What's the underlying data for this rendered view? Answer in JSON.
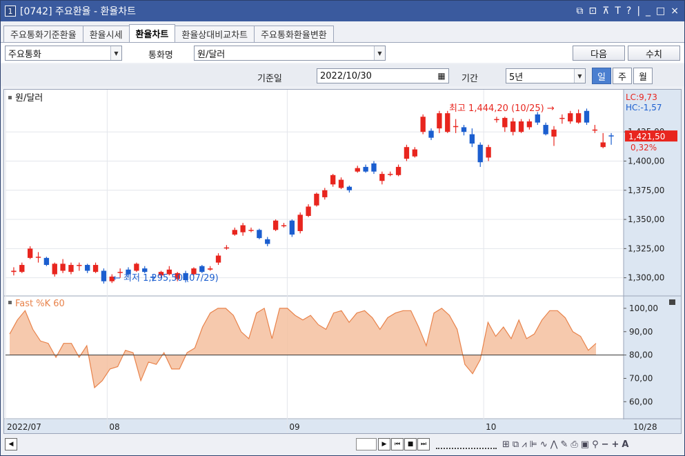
{
  "window": {
    "number": "1",
    "title": "[0742] 주요환율 - 환율차트",
    "controls": [
      "⧉",
      "⊡",
      "⊼",
      "T",
      "?",
      "|",
      "_",
      "□",
      "×"
    ]
  },
  "tabs": [
    {
      "label": "주요통화기준환율",
      "active": false
    },
    {
      "label": "환율시세",
      "active": false
    },
    {
      "label": "환율차트",
      "active": true
    },
    {
      "label": "환율상대비교차트",
      "active": false
    },
    {
      "label": "주요통화환율변환",
      "active": false
    }
  ],
  "filters": {
    "currency_group": "주요통화",
    "currency_label": "통화명",
    "currency_value": "원/달러",
    "next_label": "다음",
    "refresh_label": "수치"
  },
  "query": {
    "base_date_label": "기준일",
    "base_date": "2022/10/30",
    "period_label": "기간",
    "period_value": "5년",
    "interval_buttons": [
      {
        "label": "일",
        "active": true
      },
      {
        "label": "주",
        "active": false
      },
      {
        "label": "월",
        "active": false
      }
    ]
  },
  "colors": {
    "up": "#e8251e",
    "down": "#1b5ecf",
    "stoch_fill": "#f5c09f",
    "stoch_line": "#e8824a",
    "axis_bg": "#dce6f2",
    "price_tag": "#e8251e"
  },
  "chart_data": [
    {
      "type": "candlestick",
      "title": "원/달러",
      "x_labels": [
        "2022/07",
        "08",
        "09",
        "10",
        "10/28"
      ],
      "y_ticks": [
        "1,300,00",
        "1,325,00",
        "1,350,00",
        "1,375,00",
        "1,400,00",
        "1,425,00"
      ],
      "ylim": [
        1285,
        1460
      ],
      "lc": "LC:9,73",
      "hc": "HC:-1,57",
      "current_price": "1,421,50",
      "change_pct": "0,32%",
      "high_annotation": "최고 1,444,20 (10/25)",
      "low_annotation": "최저 1,295,50 (07/29)",
      "candles": [
        {
          "o": 1305,
          "c": 1306,
          "h": 1309,
          "l": 1302
        },
        {
          "o": 1305,
          "c": 1311,
          "h": 1313,
          "l": 1304
        },
        {
          "o": 1317,
          "c": 1325,
          "h": 1327,
          "l": 1316
        },
        {
          "o": 1318,
          "c": 1318,
          "h": 1322,
          "l": 1313
        },
        {
          "o": 1317,
          "c": 1311,
          "h": 1318,
          "l": 1310
        },
        {
          "o": 1303,
          "c": 1312,
          "h": 1313,
          "l": 1301
        },
        {
          "o": 1306,
          "c": 1312,
          "h": 1316,
          "l": 1304
        },
        {
          "o": 1305,
          "c": 1311,
          "h": 1313,
          "l": 1303
        },
        {
          "o": 1311,
          "c": 1311,
          "h": 1313,
          "l": 1306
        },
        {
          "o": 1311,
          "c": 1306,
          "h": 1312,
          "l": 1304
        },
        {
          "o": 1305,
          "c": 1311,
          "h": 1313,
          "l": 1304
        },
        {
          "o": 1306,
          "c": 1297,
          "h": 1308,
          "l": 1295
        },
        {
          "o": 1297,
          "c": 1301,
          "h": 1303,
          "l": 1295.5
        },
        {
          "o": 1305,
          "c": 1305,
          "h": 1308,
          "l": 1300
        },
        {
          "o": 1307,
          "c": 1303,
          "h": 1309,
          "l": 1301
        },
        {
          "o": 1306,
          "c": 1312,
          "h": 1313,
          "l": 1305
        },
        {
          "o": 1308,
          "c": 1305,
          "h": 1310,
          "l": 1304
        },
        {
          "o": 1301,
          "c": 1300,
          "h": 1303,
          "l": 1297
        },
        {
          "o": 1302,
          "c": 1305,
          "h": 1306,
          "l": 1300
        },
        {
          "o": 1303,
          "c": 1307,
          "h": 1310,
          "l": 1302
        },
        {
          "o": 1299,
          "c": 1304,
          "h": 1305,
          "l": 1297
        },
        {
          "o": 1304,
          "c": 1298,
          "h": 1306,
          "l": 1296
        },
        {
          "o": 1303,
          "c": 1308,
          "h": 1309,
          "l": 1302
        },
        {
          "o": 1310,
          "c": 1305,
          "h": 1311,
          "l": 1304
        },
        {
          "o": 1307,
          "c": 1308,
          "h": 1310,
          "l": 1306
        },
        {
          "o": 1313,
          "c": 1319,
          "h": 1321,
          "l": 1311
        },
        {
          "o": 1326,
          "c": 1326,
          "h": 1328,
          "l": 1324
        },
        {
          "o": 1337,
          "c": 1341,
          "h": 1343,
          "l": 1336
        },
        {
          "o": 1339,
          "c": 1345,
          "h": 1347,
          "l": 1336
        },
        {
          "o": 1341,
          "c": 1341,
          "h": 1343,
          "l": 1339
        },
        {
          "o": 1341,
          "c": 1334,
          "h": 1342,
          "l": 1333
        },
        {
          "o": 1333,
          "c": 1329,
          "h": 1335,
          "l": 1327
        },
        {
          "o": 1341,
          "c": 1349,
          "h": 1350,
          "l": 1340
        },
        {
          "o": 1345,
          "c": 1345,
          "h": 1347,
          "l": 1343
        },
        {
          "o": 1349,
          "c": 1337,
          "h": 1350,
          "l": 1335
        },
        {
          "o": 1340,
          "c": 1354,
          "h": 1356,
          "l": 1338
        },
        {
          "o": 1353,
          "c": 1361,
          "h": 1363,
          "l": 1352
        },
        {
          "o": 1362,
          "c": 1372,
          "h": 1373,
          "l": 1361
        },
        {
          "o": 1369,
          "c": 1375,
          "h": 1377,
          "l": 1367
        },
        {
          "o": 1380,
          "c": 1388,
          "h": 1389,
          "l": 1378
        },
        {
          "o": 1377,
          "c": 1384,
          "h": 1386,
          "l": 1376
        },
        {
          "o": 1378,
          "c": 1375,
          "h": 1379,
          "l": 1373
        },
        {
          "o": 1391,
          "c": 1394,
          "h": 1396,
          "l": 1390
        },
        {
          "o": 1395,
          "c": 1391,
          "h": 1397,
          "l": 1390
        },
        {
          "o": 1398,
          "c": 1391,
          "h": 1400,
          "l": 1389
        },
        {
          "o": 1383,
          "c": 1389,
          "h": 1391,
          "l": 1380
        },
        {
          "o": 1389,
          "c": 1389,
          "h": 1391,
          "l": 1387
        },
        {
          "o": 1388,
          "c": 1395,
          "h": 1397,
          "l": 1387
        },
        {
          "o": 1402,
          "c": 1412,
          "h": 1414,
          "l": 1400
        },
        {
          "o": 1404,
          "c": 1410,
          "h": 1412,
          "l": 1403
        },
        {
          "o": 1425,
          "c": 1438,
          "h": 1440,
          "l": 1423
        },
        {
          "o": 1426,
          "c": 1420,
          "h": 1428,
          "l": 1418
        },
        {
          "o": 1428,
          "c": 1441,
          "h": 1443,
          "l": 1424
        },
        {
          "o": 1425,
          "c": 1441,
          "h": 1443,
          "l": 1424
        },
        {
          "o": 1430,
          "c": 1430,
          "h": 1436,
          "l": 1424
        },
        {
          "o": 1429,
          "c": 1425,
          "h": 1431,
          "l": 1422
        },
        {
          "o": 1423,
          "c": 1415,
          "h": 1428,
          "l": 1412
        },
        {
          "o": 1414,
          "c": 1399,
          "h": 1416,
          "l": 1395
        },
        {
          "o": 1403,
          "c": 1412,
          "h": 1414,
          "l": 1400
        },
        {
          "o": 1436,
          "c": 1436,
          "h": 1438,
          "l": 1433
        },
        {
          "o": 1429,
          "c": 1437,
          "h": 1438,
          "l": 1425
        },
        {
          "o": 1425,
          "c": 1434,
          "h": 1437,
          "l": 1422
        },
        {
          "o": 1425,
          "c": 1434,
          "h": 1436,
          "l": 1424
        },
        {
          "o": 1429,
          "c": 1434,
          "h": 1436,
          "l": 1427
        },
        {
          "o": 1440,
          "c": 1433,
          "h": 1442,
          "l": 1431
        },
        {
          "o": 1431,
          "c": 1423,
          "h": 1433,
          "l": 1422
        },
        {
          "o": 1421,
          "c": 1427,
          "h": 1430,
          "l": 1413
        },
        {
          "o": 1437,
          "c": 1437,
          "h": 1440,
          "l": 1432
        },
        {
          "o": 1434,
          "c": 1441,
          "h": 1443,
          "l": 1432
        },
        {
          "o": 1433,
          "c": 1441,
          "h": 1444.2,
          "l": 1432
        },
        {
          "o": 1443,
          "c": 1433,
          "h": 1445,
          "l": 1431
        },
        {
          "o": 1427,
          "c": 1427,
          "h": 1431,
          "l": 1424
        },
        {
          "o": 1412,
          "c": 1416,
          "h": 1424,
          "l": 1411
        },
        {
          "o": 1422,
          "c": 1421.5,
          "h": 1424,
          "l": 1414
        }
      ]
    },
    {
      "type": "area",
      "title": "Fast %K 60",
      "y_ticks": [
        "60,00",
        "70,00",
        "80,00",
        "90,00",
        "100,00"
      ],
      "ylim": [
        53,
        105
      ],
      "reference_line": 80,
      "values": [
        89,
        95,
        99,
        91,
        86,
        85,
        79,
        85,
        85,
        79,
        84,
        66,
        69,
        74,
        75,
        82,
        81,
        69,
        77,
        76,
        81,
        74,
        74,
        81,
        83,
        92,
        98,
        100,
        100,
        97,
        90,
        87,
        98,
        100,
        87,
        100,
        100,
        97,
        95,
        97,
        93,
        91,
        98,
        99,
        94,
        98,
        99,
        96,
        91,
        96,
        98,
        99,
        99,
        92,
        84,
        98,
        100,
        97,
        91,
        76,
        72,
        78,
        94,
        88,
        92,
        87,
        95,
        87,
        89,
        95,
        99,
        99,
        96,
        90,
        88,
        82,
        85
      ]
    }
  ],
  "nav": {
    "scroll_left": "◀",
    "buttons": [
      "▶",
      "⏮",
      "■",
      "⏭"
    ]
  }
}
